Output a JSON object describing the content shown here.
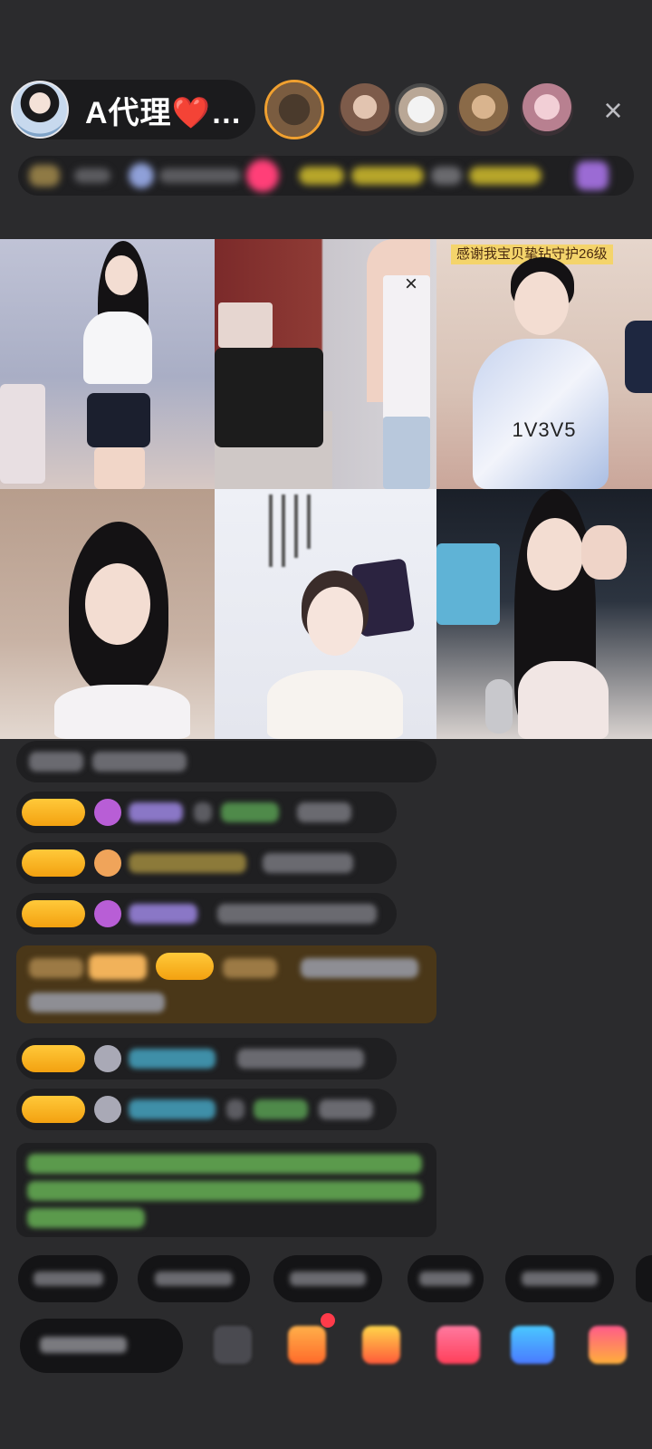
{
  "header": {
    "host_name": "A代理❤️…",
    "close_icon": "×"
  },
  "grid": {
    "cell3_banner": "感谢我宝贝挚钻守护26级",
    "cell3_overlay": "1V3V5",
    "cell2_close": "×"
  },
  "colors": {
    "background": "#2b2b2d",
    "pill": "#1b1b1d",
    "level_badge": "#f3a110",
    "gold_message": "#4a3718",
    "accent_red": "#ff3b4a"
  },
  "icons": [
    "close-icon",
    "gift-icon",
    "red-packet-icon",
    "game-icon",
    "share-icon",
    "more-icon"
  ]
}
